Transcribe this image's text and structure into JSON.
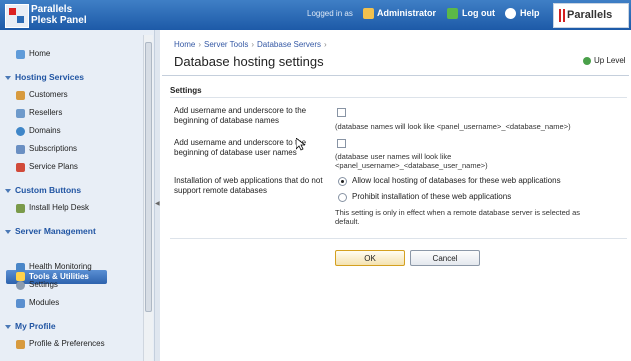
{
  "header": {
    "brand_line1": "Parallels",
    "brand_line2": "Plesk Panel",
    "logged_in_as": "Logged in as",
    "user": "Administrator",
    "logout": "Log out",
    "help": "Help",
    "vendor_logo": "Parallels"
  },
  "sidebar": {
    "home": "Home",
    "hosting_services": "Hosting Services",
    "customers": "Customers",
    "resellers": "Resellers",
    "domains": "Domains",
    "subscriptions": "Subscriptions",
    "service_plans": "Service Plans",
    "custom_buttons": "Custom Buttons",
    "install_help_desk": "Install Help Desk",
    "server_management": "Server Management",
    "tools_utilities": "Tools & Utilities",
    "health_monitoring": "Health Monitoring",
    "settings": "Settings",
    "modules": "Modules",
    "my_profile": "My Profile",
    "profile_preferences": "Profile & Preferences"
  },
  "breadcrumb": [
    "Home",
    "Server Tools",
    "Database Servers"
  ],
  "page": {
    "title": "Database hosting settings",
    "up_level": "Up Level",
    "group_title": "Settings",
    "row1_label": "Add username and underscore to the beginning of database names",
    "row1_hint": "(database names will look like <panel_username>_<database_name>)",
    "row2_label": "Add username and underscore to the beginning of database user names",
    "row2_hint_1": "(database user names will look like",
    "row2_hint_2": "<panel_username>_<database_user_name>)",
    "row3_label": "Installation of web applications that do not support remote databases",
    "radio1": "Allow local hosting of databases for these web applications",
    "radio2": "Prohibit installation of these web applications",
    "note_1": "This setting is only in effect when a remote database server is selected as",
    "note_2": "default.",
    "ok": "OK",
    "cancel": "Cancel"
  },
  "colors": {
    "header": "#2d66b0",
    "sidebar": "#e8eef6",
    "section": "#2155a3",
    "ok_border": "#d4a020"
  }
}
